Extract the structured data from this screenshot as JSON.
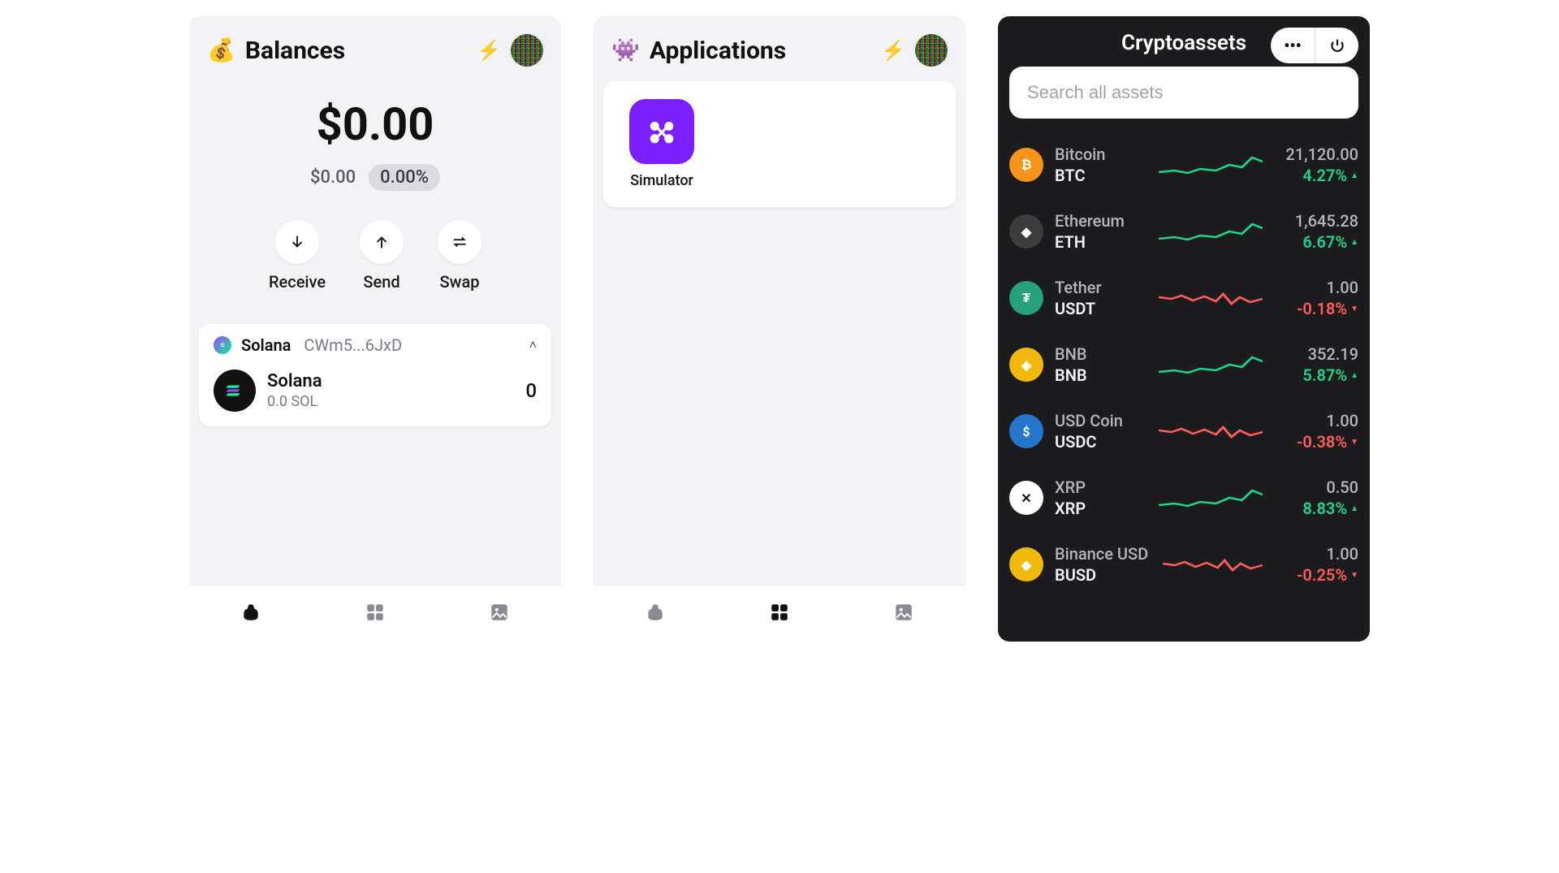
{
  "balances": {
    "title": "Balances",
    "header_icon": "💰",
    "total": "$0.00",
    "change_amount": "$0.00",
    "change_pct": "0.00%",
    "actions": {
      "receive": "Receive",
      "send": "Send",
      "swap": "Swap"
    },
    "wallet": {
      "chain": "Solana",
      "address_short": "CWm5...6JxD",
      "token_name": "Solana",
      "token_amount": "0.0 SOL",
      "token_balance": "0"
    }
  },
  "applications": {
    "title": "Applications",
    "header_icon": "👾",
    "apps": [
      {
        "label": "Simulator"
      }
    ]
  },
  "cryptoassets": {
    "title": "Cryptoassets",
    "search_placeholder": "Search all assets",
    "assets": [
      {
        "name": "Bitcoin",
        "symbol": "BTC",
        "price": "21,120.00",
        "change": "4.27%",
        "direction": "up",
        "icon_bg": "#f7931a",
        "icon_text": "₿"
      },
      {
        "name": "Ethereum",
        "symbol": "ETH",
        "price": "1,645.28",
        "change": "6.67%",
        "direction": "up",
        "icon_bg": "#3c3c3d",
        "icon_text": "◆"
      },
      {
        "name": "Tether",
        "symbol": "USDT",
        "price": "1.00",
        "change": "-0.18%",
        "direction": "down",
        "icon_bg": "#26a17b",
        "icon_text": "₮"
      },
      {
        "name": "BNB",
        "symbol": "BNB",
        "price": "352.19",
        "change": "5.87%",
        "direction": "up",
        "icon_bg": "#f0b90b",
        "icon_text": "◈"
      },
      {
        "name": "USD Coin",
        "symbol": "USDC",
        "price": "1.00",
        "change": "-0.38%",
        "direction": "down",
        "icon_bg": "#2775ca",
        "icon_text": "$"
      },
      {
        "name": "XRP",
        "symbol": "XRP",
        "price": "0.50",
        "change": "8.83%",
        "direction": "up",
        "icon_bg": "#ffffff",
        "icon_text": "✕",
        "icon_fg": "#111"
      },
      {
        "name": "Binance USD",
        "symbol": "BUSD",
        "price": "1.00",
        "change": "-0.25%",
        "direction": "down",
        "icon_bg": "#f0b90b",
        "icon_text": "◆"
      }
    ]
  }
}
